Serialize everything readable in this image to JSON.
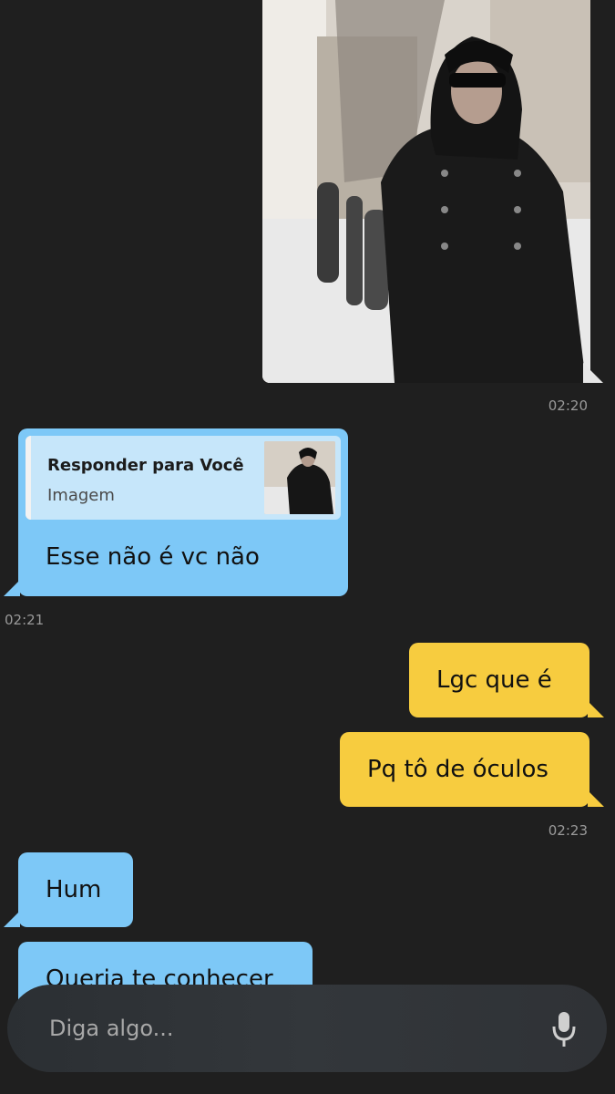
{
  "messages": {
    "photo_time": "02:20",
    "reply": {
      "title": "Responder para Você",
      "subtitle": "Imagem",
      "text": "Esse não é vc não",
      "time": "02:21"
    },
    "sent1": {
      "text": "Lgc que é"
    },
    "sent2": {
      "text": "Pq tô de óculos",
      "time": "02:23"
    },
    "recv1": {
      "text": "Hum"
    },
    "recv2": {
      "text": "Queria te conhecer"
    }
  },
  "input": {
    "placeholder": "Diga algo...",
    "mic_icon": "microphone-icon"
  },
  "colors": {
    "background": "#1f1f1f",
    "received_bubble": "#7dc8f7",
    "sent_bubble": "#f7cc3f",
    "timestamp": "#9a9a9a"
  }
}
